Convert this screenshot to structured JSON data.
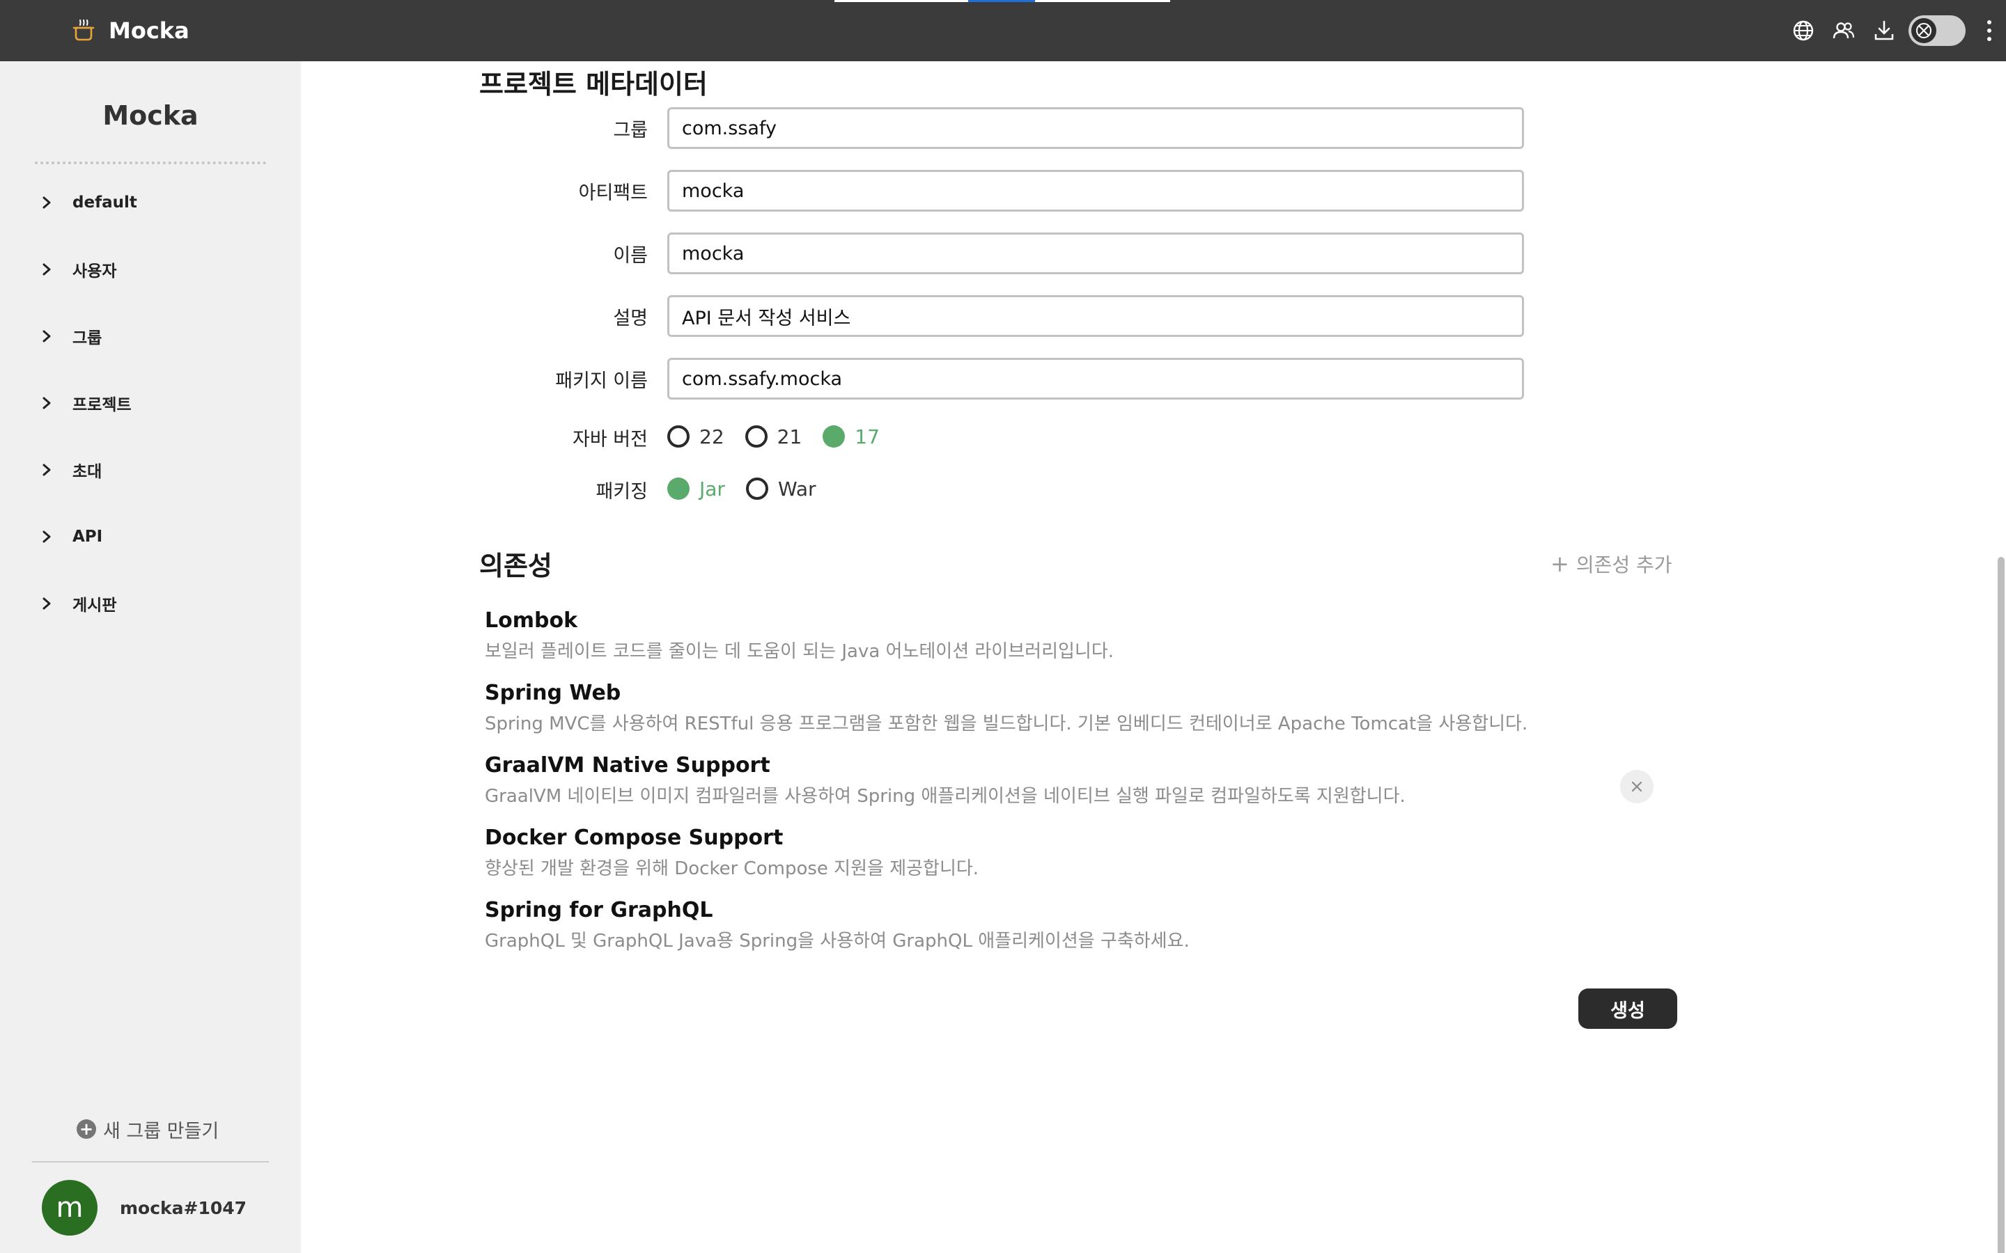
{
  "app": {
    "name": "Mocka",
    "logo_icon": "cooking-pot-icon"
  },
  "colors": {
    "topbar": "#3b3b3b",
    "sidebar": "#f0f0f0",
    "accent_green": "#5aab6b",
    "tab_indicator_white": "#ffffff",
    "tab_indicator_blue": "#1f6fd6",
    "button_dark": "#2c2c2c",
    "avatar": "#2a6e22"
  },
  "toolbar": {
    "icons": [
      "globe-icon",
      "users-icon",
      "download-icon"
    ],
    "toggle_icon": "no-connection-icon",
    "menu_icon": "more-vertical-icon"
  },
  "sidebar": {
    "title": "Mocka",
    "items": [
      {
        "label": "default"
      },
      {
        "label": "사용자"
      },
      {
        "label": "그룹"
      },
      {
        "label": "프로젝트"
      },
      {
        "label": "초대"
      },
      {
        "label": "API"
      },
      {
        "label": "게시판"
      }
    ],
    "new_group_label": "새 그룹 만들기",
    "user": {
      "avatar_letter": "m",
      "name": "mocka#1047"
    }
  },
  "metadata": {
    "title": "프로젝트 메타데이터",
    "fields": [
      {
        "label": "그룹",
        "value": "com.ssafy"
      },
      {
        "label": "아티팩트",
        "value": "mocka"
      },
      {
        "label": "이름",
        "value": "mocka"
      },
      {
        "label": "설명",
        "value": "API 문서 작성 서비스"
      },
      {
        "label": "패키지 이름",
        "value": "com.ssafy.mocka"
      }
    ],
    "java_version": {
      "label": "자바 버전",
      "options": [
        "22",
        "21",
        "17"
      ],
      "selected": "17"
    },
    "packaging": {
      "label": "패키징",
      "options": [
        "Jar",
        "War"
      ],
      "selected": "Jar"
    }
  },
  "dependencies": {
    "title": "의존성",
    "add_label": "의존성 추가",
    "items": [
      {
        "name": "Lombok",
        "description": "보일러 플레이트 코드를 줄이는 데 도움이 되는 Java 어노테이션 라이브러리입니다."
      },
      {
        "name": "Spring Web",
        "description": "Spring MVC를 사용하여 RESTful 응용 프로그램을 포함한 웹을 빌드합니다. 기본 임베디드 컨테이너로 Apache Tomcat을 사용합니다."
      },
      {
        "name": "GraalVM Native Support",
        "description": "GraalVM 네이티브 이미지 컴파일러를 사용하여 Spring 애플리케이션을 네이티브 실행 파일로 컴파일하도록 지원합니다."
      },
      {
        "name": "Docker Compose Support",
        "description": "향상된 개발 환경을 위해 Docker Compose 지원을 제공합니다."
      },
      {
        "name": "Spring for GraphQL",
        "description": "GraphQL 및 GraphQL Java용 Spring을 사용하여 GraphQL 애플리케이션을 구축하세요."
      }
    ]
  },
  "actions": {
    "create_label": "생성"
  }
}
